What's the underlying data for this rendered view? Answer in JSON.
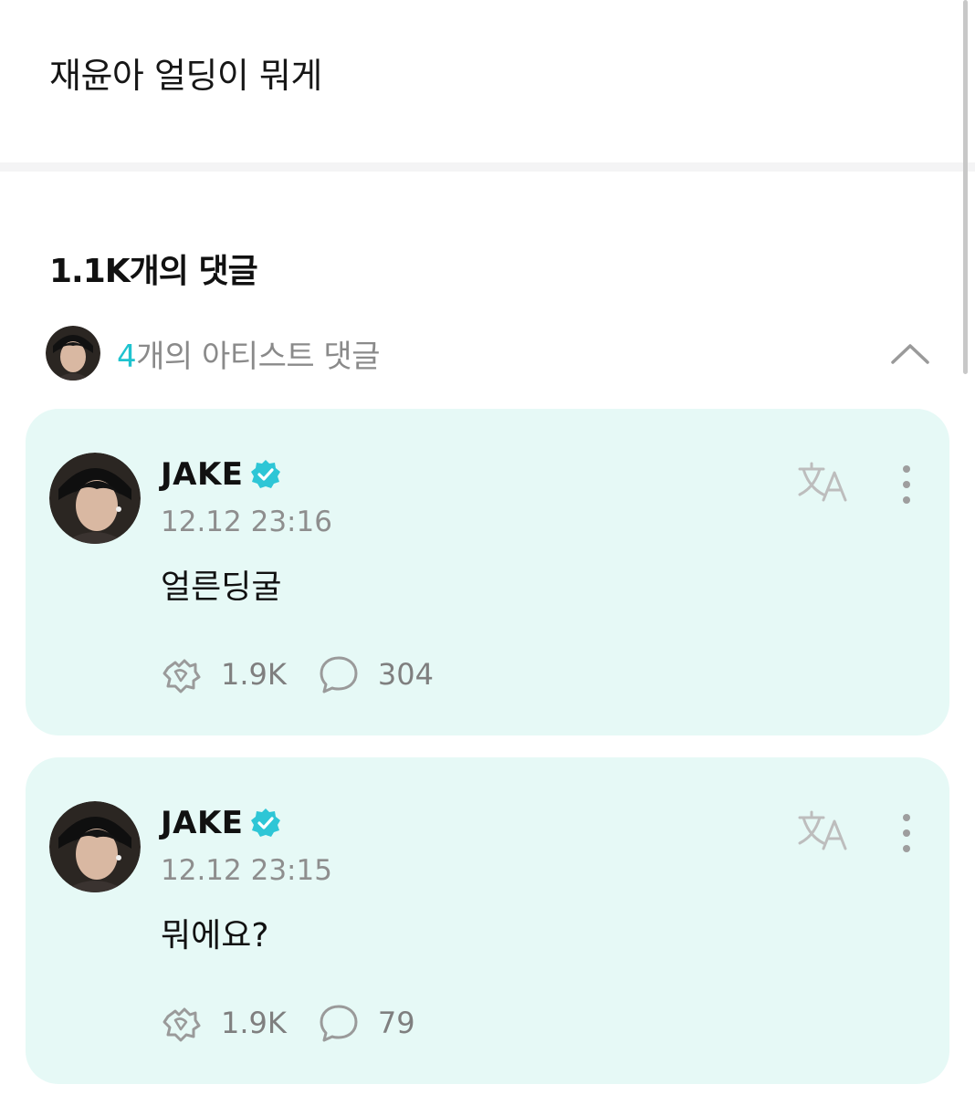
{
  "post": {
    "text": "재윤아 얼딩이 뭐게"
  },
  "comments_section": {
    "count_label": "1.1K개의 댓글",
    "artist_comments": {
      "count": "4",
      "label": "개의 아티스트 댓글"
    }
  },
  "comments": [
    {
      "author": "JAKE",
      "verified": true,
      "time": "12.12 23:16",
      "text": "얼른딩굴",
      "likes": "1.9K",
      "replies": "304"
    },
    {
      "author": "JAKE",
      "verified": true,
      "time": "12.12 23:15",
      "text": "뭐에요?",
      "likes": "1.9K",
      "replies": "79"
    }
  ],
  "icons": {
    "verified": "verified-badge-icon",
    "translate": "translate-icon",
    "more": "more-vertical-icon",
    "like": "like-icon",
    "reply": "comment-bubble-icon",
    "collapse": "chevron-up-icon"
  },
  "colors": {
    "accent": "#1fc3cf",
    "card_background": "#e6f9f6",
    "muted_text": "#8e8e8e"
  }
}
